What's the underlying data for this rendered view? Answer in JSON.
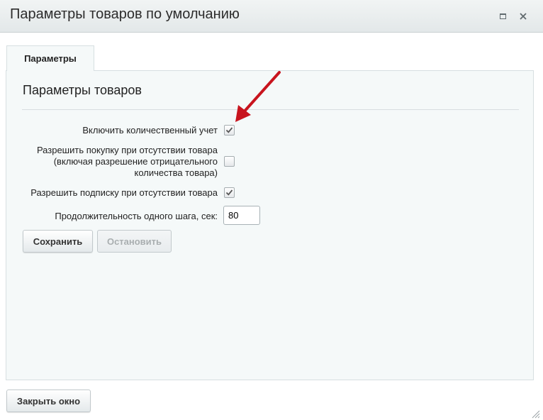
{
  "window": {
    "title": "Параметры товаров по умолчанию",
    "maximize_icon": "maximize-icon",
    "close_icon": "close-icon"
  },
  "tabs": [
    {
      "label": "Параметры",
      "active": true
    }
  ],
  "section": {
    "title": "Параметры товаров"
  },
  "form": {
    "enable_quantity": {
      "label": "Включить количественный учет",
      "checked": true
    },
    "allow_purchase": {
      "label": "Разрешить покупку при отсутствии товара (включая разрешение отрицательного количества товара)",
      "checked": false
    },
    "allow_subscribe": {
      "label": "Разрешить подписку при отсутствии товара",
      "checked": true
    },
    "step_duration": {
      "label": "Продолжительность одного шага, сек:",
      "value": "80"
    }
  },
  "buttons": {
    "save": "Сохранить",
    "stop": "Остановить",
    "close_window": "Закрыть окно"
  },
  "colors": {
    "titlebar": "#e9eef0",
    "panel": "#f5f9f9",
    "annotation_arrow": "#c8141e"
  }
}
